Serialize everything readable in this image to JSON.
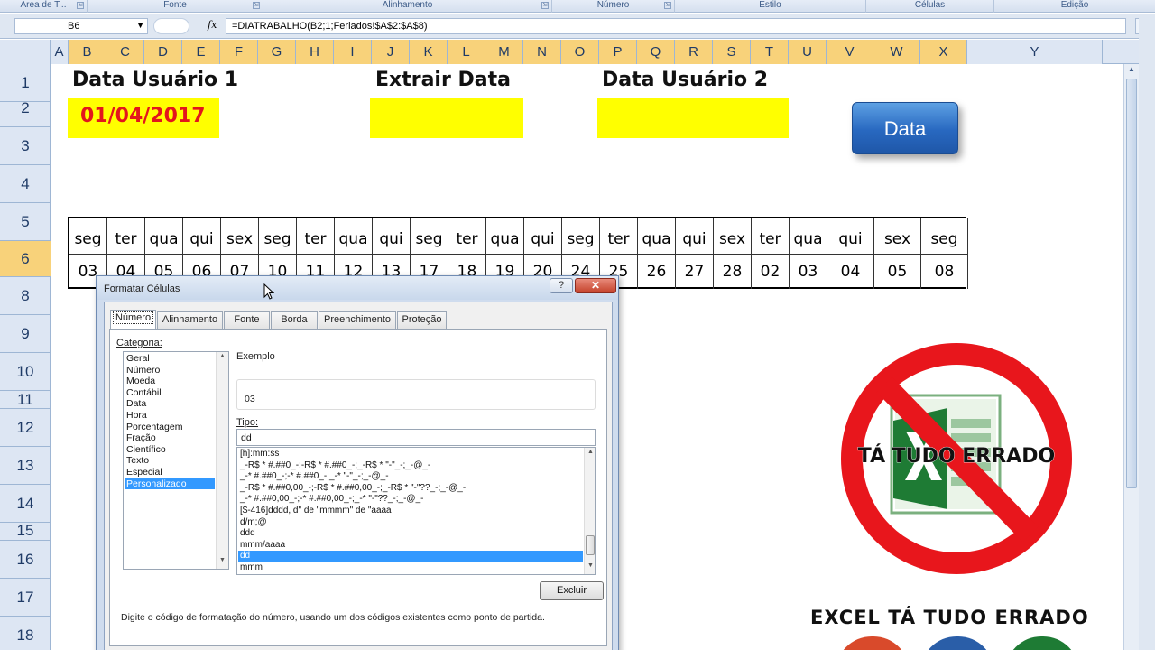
{
  "ribbon": {
    "groups": [
      {
        "label": "Área de T...",
        "launcher": "⇲"
      },
      {
        "label": "Fonte",
        "launcher": "⇲"
      },
      {
        "label": "Alinhamento",
        "launcher": "⇲"
      },
      {
        "label": "Número",
        "launcher": "⇲"
      },
      {
        "label": "Estilo",
        "launcher": ""
      },
      {
        "label": "Células",
        "launcher": ""
      },
      {
        "label": "Edição",
        "launcher": ""
      }
    ]
  },
  "formula_bar": {
    "name_box": "B6",
    "fx": "fx",
    "formula": "=DIATRABALHO(B2;1;Feriados!$A$2:$A$8)"
  },
  "columns": [
    "A",
    "B",
    "C",
    "D",
    "E",
    "F",
    "G",
    "H",
    "I",
    "J",
    "K",
    "L",
    "M",
    "N",
    "O",
    "P",
    "Q",
    "R",
    "S",
    "T",
    "U",
    "V",
    "W",
    "X",
    "Y"
  ],
  "rows": [
    "1",
    "2",
    "3",
    "4",
    "5",
    "6",
    "8",
    "9",
    "10",
    "11",
    "12",
    "13",
    "14",
    "15",
    "16",
    "17",
    "18"
  ],
  "sheet": {
    "label_user1": "Data Usuário 1",
    "label_extract": "Extrair Data",
    "label_user2": "Data Usuário 2",
    "user1_date": "01/04/2017",
    "button_label": "Data",
    "weekdays": [
      "seg",
      "ter",
      "qua",
      "qui",
      "sex",
      "seg",
      "ter",
      "qua",
      "qui",
      "seg",
      "ter",
      "qua",
      "qui",
      "seg",
      "ter",
      "qua",
      "qui",
      "sex",
      "ter",
      "qua",
      "qui",
      "sex",
      "seg"
    ],
    "daynums": [
      "03",
      "04",
      "05",
      "06",
      "07",
      "10",
      "11",
      "12",
      "13",
      "17",
      "18",
      "19",
      "20",
      "24",
      "25",
      "26",
      "27",
      "28",
      "02",
      "03",
      "04",
      "05",
      "08"
    ]
  },
  "dialog": {
    "title": "Formatar Células",
    "help": "?",
    "close": "✕",
    "tabs": [
      "Número",
      "Alinhamento",
      "Fonte",
      "Borda",
      "Preenchimento",
      "Proteção"
    ],
    "category_label": "Categoria:",
    "categories": [
      "Geral",
      "Número",
      "Moeda",
      "Contábil",
      "Data",
      "Hora",
      "Porcentagem",
      "Fração",
      "Científico",
      "Texto",
      "Especial",
      "Personalizado"
    ],
    "selected_category": "Personalizado",
    "example_label": "Exemplo",
    "example_value": "03",
    "type_label": "Tipo:",
    "type_value": "dd",
    "formats": [
      "[h]:mm:ss",
      "_-R$ * #.##0_-;-R$ * #.##0_-;_-R$ * \"-\"_-;_-@_-",
      "_-* #.##0_-;-* #.##0_-;_-* \"-\"_-;_-@_-",
      "_-R$ * #.##0,00_-;-R$ * #.##0,00_-;_-R$ * \"-\"??_-;_-@_-",
      "_-* #.##0,00_-;-* #.##0,00_-;_-* \"-\"??_-;_-@_-",
      "[$-416]dddd, d\" de \"mmmm\" de \"aaaa",
      "d/m;@",
      "ddd",
      "mmm/aaaa",
      "dd",
      "mmm"
    ],
    "selected_format": "dd",
    "delete_label": "Excluir",
    "hint": "Digite o código de formatação do número, usando um dos códigos existentes como ponto de partida."
  },
  "logo": {
    "overlay_text": "TÁ TUDO ERRADO",
    "caption": "EXCEL TÁ TUDO ERRADO"
  },
  "colors": {
    "highlight_yellow": "#ffff00",
    "date_red": "#e3161c",
    "selected_header": "#f8d27a",
    "button_blue": "#2868c0",
    "prohibit_red": "#e8161c",
    "excel_green": "#1e7b34"
  }
}
